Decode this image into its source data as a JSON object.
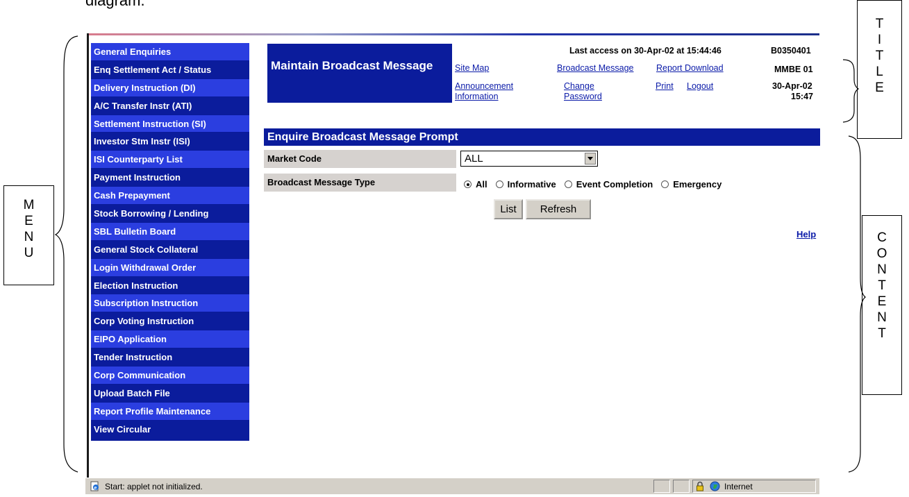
{
  "caption": "diagram.",
  "annotations": {
    "title_letters": [
      "T",
      "I",
      "T",
      "L",
      "E"
    ],
    "menu_letters": [
      "M",
      "E",
      "N",
      "U"
    ],
    "content_letters": [
      "C",
      "O",
      "N",
      "T",
      "E",
      "N",
      "T"
    ]
  },
  "menu": {
    "items": [
      {
        "label": "General Enquiries"
      },
      {
        "label": "Enq Settlement Act / Status"
      },
      {
        "label": "Delivery Instruction (DI)"
      },
      {
        "label": "A/C Transfer Instr (ATI)"
      },
      {
        "label": "Settlement Instruction (SI)"
      },
      {
        "label": "Investor Stm Instr (ISI)"
      },
      {
        "label": "ISI Counterparty List"
      },
      {
        "label": "Payment Instruction"
      },
      {
        "label": "Cash Prepayment"
      },
      {
        "label": "Stock Borrowing / Lending"
      },
      {
        "label": "SBL Bulletin Board"
      },
      {
        "label": "General Stock Collateral"
      },
      {
        "label": "Login Withdrawal Order"
      },
      {
        "label": "Election Instruction"
      },
      {
        "label": "Subscription Instruction"
      },
      {
        "label": "Corp Voting Instruction"
      },
      {
        "label": "EIPO Application"
      },
      {
        "label": "Tender Instruction"
      },
      {
        "label": "Corp Communication"
      },
      {
        "label": "Upload Batch File"
      },
      {
        "label": "Report Profile Maintenance"
      },
      {
        "label": "View Circular"
      }
    ],
    "colors": {
      "light": "#2b3ee0",
      "dark": "#0b1c9c"
    }
  },
  "header": {
    "page_title": "Maintain Broadcast Message",
    "last_access": "Last access on 30-Apr-02 at 15:44:46",
    "user_id": "B0350401",
    "system_code": "MMBE 01",
    "date": "30-Apr-02",
    "time": "15:47",
    "links": {
      "site_map": "Site Map",
      "broadcast_message": "Broadcast Message",
      "report_download": "Report Download",
      "announcement_1": "Announcement",
      "announcement_2": "Information",
      "change_password_1": "Change",
      "change_password_2": "Password",
      "print": "Print",
      "logout": "Logout"
    }
  },
  "content": {
    "heading": "Enquire Broadcast Message Prompt",
    "market_code_label": "Market Code",
    "market_code_value": "ALL",
    "message_type_label": "Broadcast Message Type",
    "message_types": [
      {
        "label": "All",
        "checked": true
      },
      {
        "label": "Informative",
        "checked": false
      },
      {
        "label": "Event Completion",
        "checked": false
      },
      {
        "label": "Emergency",
        "checked": false
      }
    ],
    "list_button": "List",
    "refresh_button": "Refresh",
    "help_link": "Help"
  },
  "statusbar": {
    "status_text": "Start: applet not initialized.",
    "zone": "Internet"
  }
}
